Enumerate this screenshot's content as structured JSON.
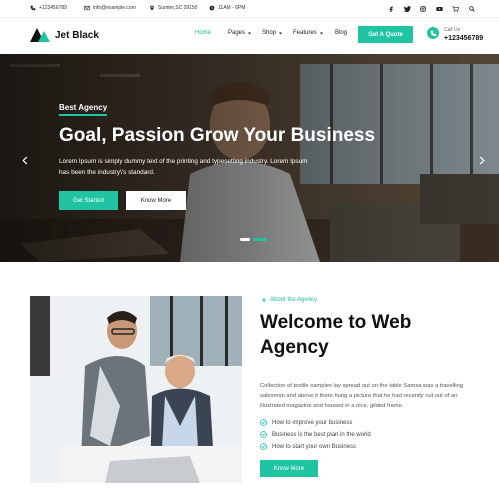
{
  "topbar": {
    "phone": "+123456789",
    "email": "info@example.com",
    "address": "Sumter,SC 29150",
    "hours": "11AM - 6PM",
    "social_icons": [
      "facebook-icon",
      "twitter-icon",
      "instagram-icon",
      "youtube-icon",
      "cart-icon",
      "search-icon"
    ]
  },
  "header": {
    "logo_text": "Jet Black",
    "nav": [
      {
        "label": "Home",
        "active": true
      },
      {
        "label": "Pages",
        "dropdown": true
      },
      {
        "label": "Shop",
        "dropdown": true
      },
      {
        "label": "Features",
        "dropdown": true
      },
      {
        "label": "Blog"
      }
    ],
    "quote_button": "Get A Quote",
    "call_label": "Call Us",
    "call_number": "+123456789"
  },
  "hero": {
    "tag": "Best Agency",
    "title": "Goal, Passion Grow Your Business",
    "text": "Lorem Ipsum is simply dummy text of the printing and typesetting industry. Lorem Ipsum has been the industry\\'s standard.",
    "primary_button": "Get Started",
    "secondary_button": "Know More",
    "slides": 2,
    "active_slide": 2
  },
  "about": {
    "tag": "About the Agency",
    "title": "Welcome to Web Agency",
    "text": "Collection of textile samples lay spread out on the table Samsa was a travelling salesman and above it there hung a picture that he had recently cut out of an illustrated magazine and housed in a nice, gilded frame.",
    "checklist": [
      "How to improve your business",
      "Business is the best plan in the world",
      "How to start your own Business"
    ],
    "button": "Know More"
  },
  "colors": {
    "accent": "#20c3a2",
    "dark": "#111111"
  }
}
